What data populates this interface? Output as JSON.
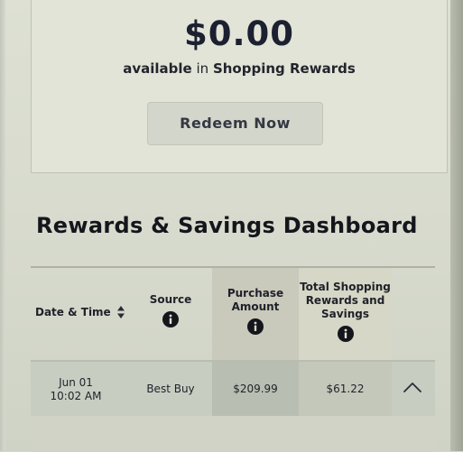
{
  "rewards": {
    "amount": "$0.00",
    "available_word": "available",
    "available_in": "in",
    "program_name": "Shopping Rewards",
    "redeem_label": "Redeem Now"
  },
  "dashboard": {
    "title": "Rewards & Savings Dashboard",
    "columns": {
      "date": "Date & Time",
      "source": "Source",
      "purchase_line1": "Purchase",
      "purchase_line2": "Amount",
      "total_line1": "Total Shopping",
      "total_line2": "Rewards and",
      "total_line3": "Savings"
    },
    "rows": [
      {
        "date": "Jun 01",
        "time": "10:02 AM",
        "source": "Best Buy",
        "purchase_amount": "$209.99",
        "total_rewards": "$61.22"
      }
    ]
  },
  "icons": {
    "info": "info-icon",
    "sort": "sort-icon",
    "expand": "chevron-up-icon"
  },
  "colors": {
    "text_dark": "#1c2030",
    "button_bg": "#d3d6ca",
    "purchase_column": "#c9c9bc",
    "total_column": "#d6d7c6"
  }
}
